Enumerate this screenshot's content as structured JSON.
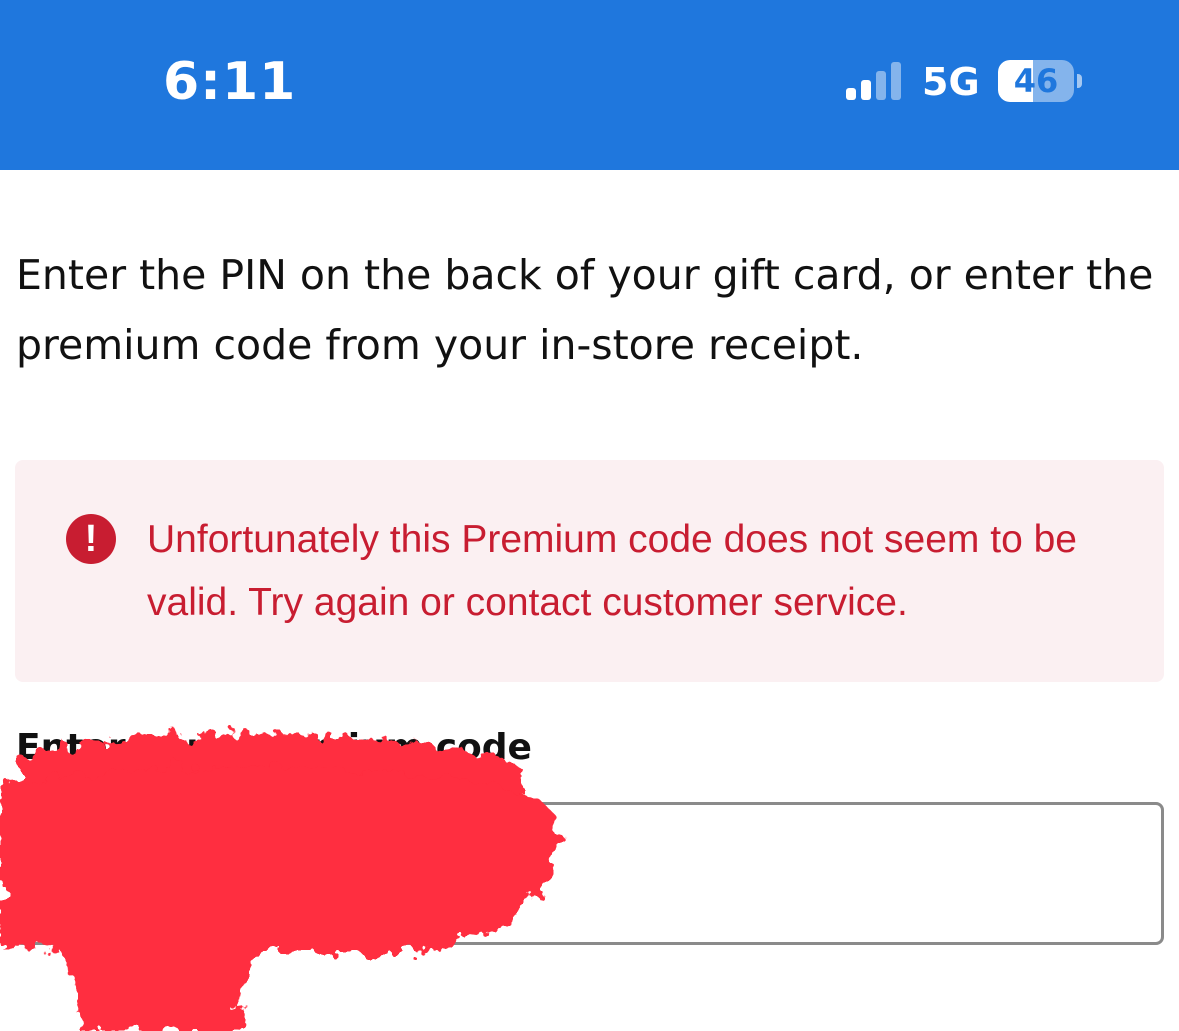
{
  "status_bar": {
    "time": "6:11",
    "network": "5G",
    "battery_level": "46",
    "battery_fraction": 0.46,
    "signal_bars_active": 2,
    "signal_bars_total": 4,
    "background_color": "#1f77dd"
  },
  "page": {
    "instructions": "Enter the PIN on the back of your gift card, or enter the premium code from your in-store receipt."
  },
  "alert": {
    "icon": "exclamation-circle-icon",
    "icon_glyph": "!",
    "message": "Unfortunately this Premium code does not seem to be valid. Try again or contact customer service.",
    "color": "#c81d31",
    "background_color": "#fbf0f2"
  },
  "premium_code_field": {
    "label": "Enter your premium code",
    "value": ""
  },
  "redaction": {
    "color": "#ff2d3f"
  }
}
